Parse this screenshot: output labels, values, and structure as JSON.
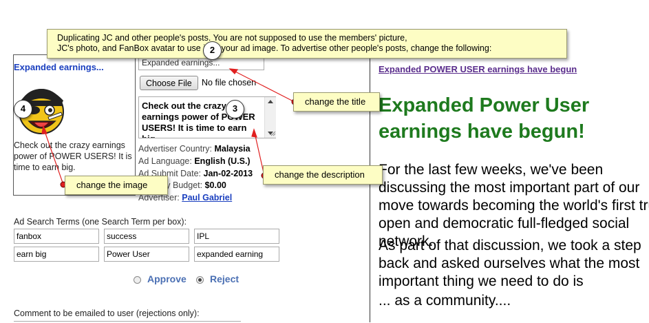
{
  "callout": {
    "line1": "Duplicating JC and other people's posts. You are not supposed to use the members' picture,",
    "line2": "JC's photo, and FanBox avatar to use it as your ad image. To advertise other people's posts, change the following:"
  },
  "ad_preview": {
    "title": "Expanded earnings...",
    "description": "Check out the crazy earnings power of POWER USERS! It is time to earn big.",
    "image_icon": "pirate-smiley-icon"
  },
  "form": {
    "title_value": "Expanded earnings...",
    "choose_file_label": "Choose File",
    "file_status": "No file chosen",
    "description_value": "Check out the crazy earnings power of POWER USERS! It is time to earn big."
  },
  "meta": {
    "country_label": "Advertiser Country:",
    "country_value": "Malaysia",
    "language_label": "Ad Language:",
    "language_value": "English (U.S.)",
    "submit_label": "Ad Submit Date:",
    "submit_value": "Jan-02-2013",
    "budget_label": "Ad Daily Budget:",
    "budget_value": "$0.00",
    "advertiser_label": "Advertiser:",
    "advertiser_value": "Paul Gabriel"
  },
  "search_terms": {
    "label": "Ad Search Terms (one Search Term per box):",
    "terms": [
      "fanbox",
      "success",
      "IPL",
      "earn big",
      "Power User",
      "expanded earning"
    ]
  },
  "decision": {
    "approve_label": "Approve",
    "reject_label": "Reject",
    "selected": "Reject"
  },
  "comment": {
    "label": "Comment to be emailed to user (rejections only):"
  },
  "post_preview": {
    "link": "Expanded POWER USER earnings have begun",
    "heading": "Expanded Power User earnings have begun!",
    "paragraph1": "For the last few weeks, we've been discussing the most important part of our move towards becoming the world's first truly open and democratic full-fledged social network.",
    "paragraph2": "As part of that discussion, we took a step back and asked ourselves what the most important thing we need to do is",
    "paragraph3": "... as a community...."
  },
  "annotations": {
    "num1": "2",
    "num2": "3",
    "num3": "4",
    "change_title": "change the title",
    "change_description": "change the description",
    "change_image": "change the image"
  },
  "colors": {
    "note_bg": "#fdfdc4",
    "arrow": "#e02020",
    "heading_green": "#1e7a1e",
    "link_blue": "#1a3fbf"
  }
}
